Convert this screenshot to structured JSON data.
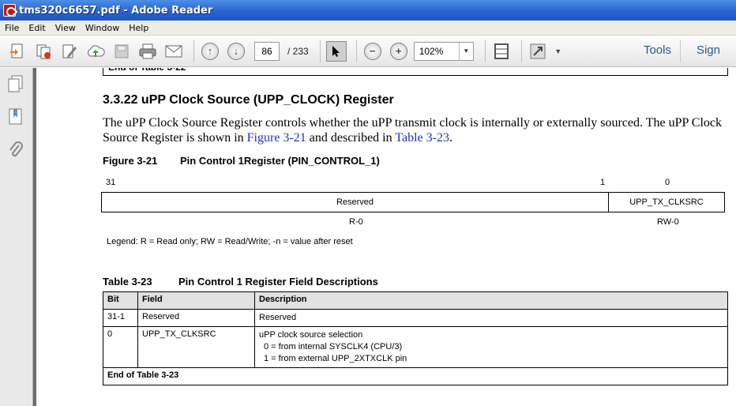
{
  "window": {
    "title": "tms320c6657.pdf - Adobe Reader"
  },
  "menu": [
    "File",
    "Edit",
    "View",
    "Window",
    "Help"
  ],
  "toolbar": {
    "page_current": "86",
    "page_total": "/ 233",
    "zoom": "102%",
    "tools_label": "Tools",
    "sign_label": "Sign"
  },
  "doc": {
    "prev_table_end": "End of Table 3-22",
    "section_heading": "3.3.22  uPP Clock Source (UPP_CLOCK) Register",
    "body": {
      "text_1": "The uPP Clock Source Register controls whether the uPP transmit clock is internally or externally sourced. The uPP Clock Source Register is shown in ",
      "link_1": "Figure 3-21",
      "text_2": " and described in ",
      "link_2": "Table 3-23",
      "text_3": "."
    },
    "figure": {
      "number": "Figure 3-21",
      "title": "Pin Control 1Register (PIN_CONTROL_1)",
      "bit_hi": "31",
      "bit_mid": "1",
      "bit_lo": "0",
      "field_reserved": "Reserved",
      "field_upp": "UPP_TX_CLKSRC",
      "access_reserved": "R-0",
      "access_upp": "RW-0",
      "legend": "Legend: R = Read only; RW = Read/Write; -n = value after reset"
    },
    "table": {
      "number": "Table 3-23",
      "title": "Pin Control 1 Register Field Descriptions",
      "headers": [
        "Bit",
        "Field",
        "Description"
      ],
      "rows": [
        {
          "bit": "31-1",
          "field": "Reserved",
          "desc": [
            "Reserved"
          ]
        },
        {
          "bit": "0",
          "field": "UPP_TX_CLKSRC",
          "desc": [
            "uPP clock source selection",
            "0 = from internal SYSCLK4 (CPU/3)",
            "1 = from external UPP_2XTXCLK pin"
          ]
        }
      ],
      "end": "End of Table 3-23"
    }
  }
}
